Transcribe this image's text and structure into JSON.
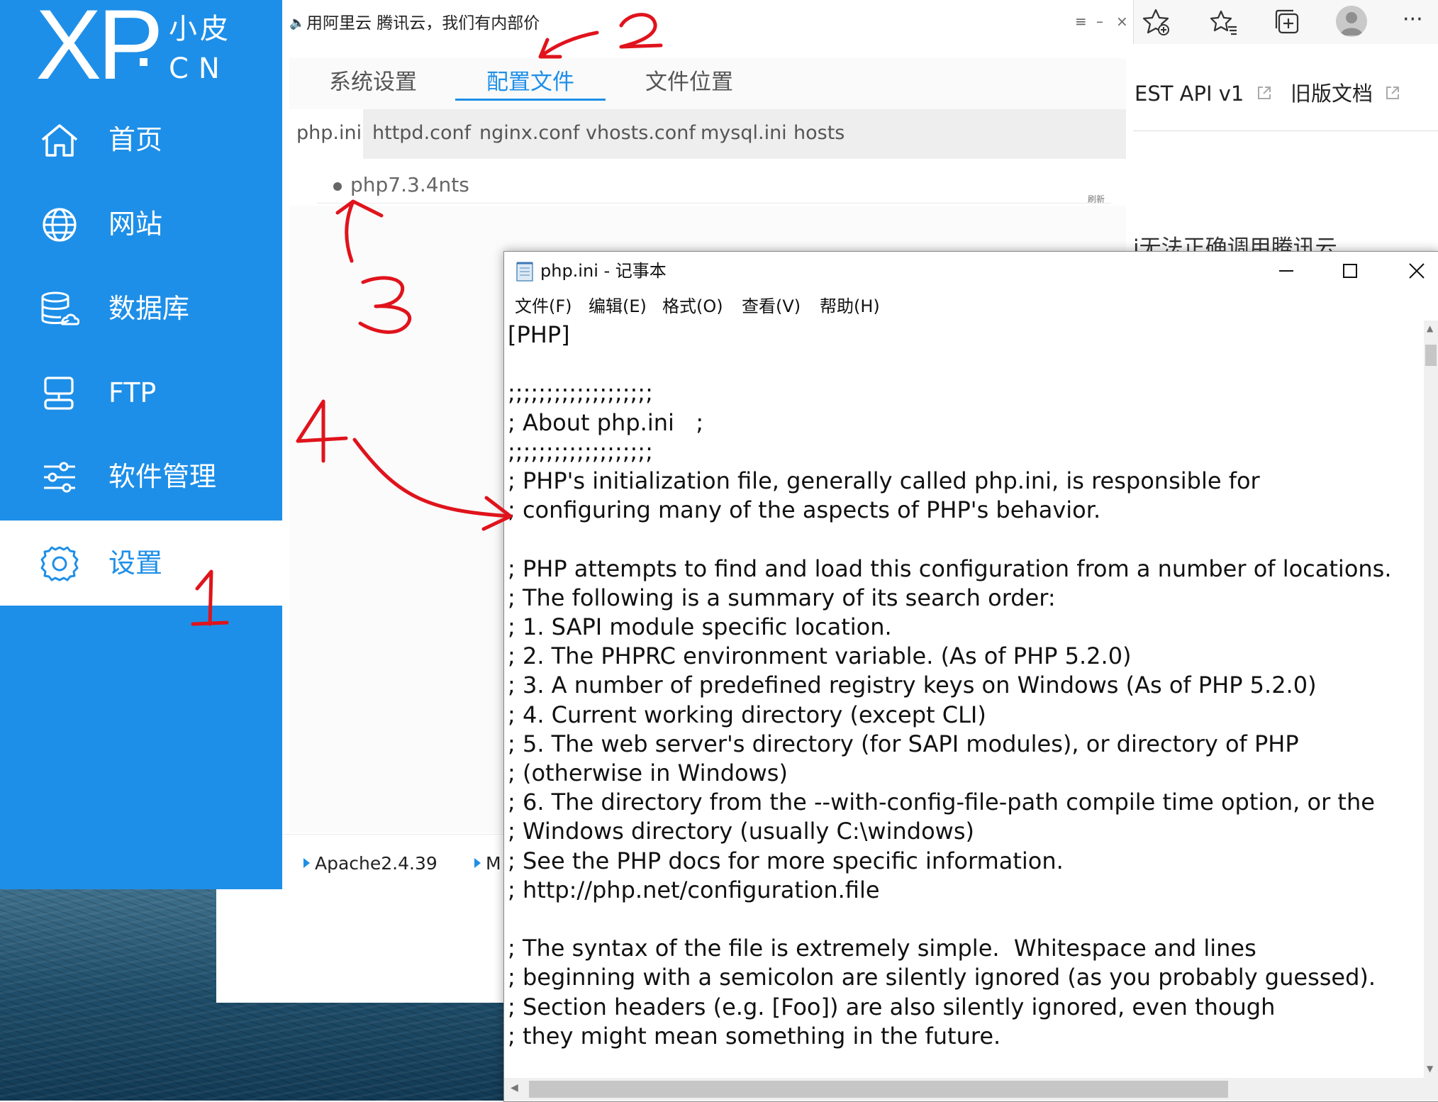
{
  "xp_app": {
    "logo": {
      "xp": "XP",
      "cn_top": "小皮",
      "cn_bottom": "CN"
    },
    "nav": [
      {
        "label": "首页",
        "icon": "home-icon"
      },
      {
        "label": "网站",
        "icon": "globe-icon"
      },
      {
        "label": "数据库",
        "icon": "database-icon"
      },
      {
        "label": "FTP",
        "icon": "ftp-icon"
      },
      {
        "label": "软件管理",
        "icon": "sliders-icon"
      },
      {
        "label": "设置",
        "icon": "gear-icon",
        "active": true
      }
    ],
    "ad_text": "用阿里云 腾讯云，我们有内部价",
    "window_controls": {
      "menu": "≡",
      "minimize": "–",
      "close": "×"
    },
    "tabs": [
      "系统设置",
      "配置文件",
      "文件位置"
    ],
    "active_tab": "配置文件",
    "config_tabs": [
      "php.ini",
      "httpd.conf",
      "nginx.conf",
      "vhosts.conf",
      "mysql.ini",
      "hosts"
    ],
    "active_config_tab": "php.ini",
    "php_version": "php7.3.4nts",
    "refresh_label": "刷新",
    "services": [
      "Apache2.4.39",
      "M"
    ]
  },
  "browser": {
    "nav_links": [
      "EST API v1",
      "旧版文档"
    ],
    "cut_text": "i无法正确调用腾讯云",
    "toolbar_icons": [
      "favorite-add-icon",
      "favorites-icon",
      "collections-icon",
      "profile-avatar",
      "more-icon"
    ],
    "more_label": "···"
  },
  "notepad": {
    "title": "php.ini - 记事本",
    "menu": [
      "文件(F)",
      "编辑(E)",
      "格式(O)",
      "查看(V)",
      "帮助(H)"
    ],
    "content": "[PHP]\n\n;;;;;;;;;;;;;;;;;;;\n; About php.ini   ;\n;;;;;;;;;;;;;;;;;;;\n; PHP's initialization file, generally called php.ini, is responsible for\n; configuring many of the aspects of PHP's behavior.\n\n; PHP attempts to find and load this configuration from a number of locations.\n; The following is a summary of its search order:\n; 1. SAPI module specific location.\n; 2. The PHPRC environment variable. (As of PHP 5.2.0)\n; 3. A number of predefined registry keys on Windows (As of PHP 5.2.0)\n; 4. Current working directory (except CLI)\n; 5. The web server's directory (for SAPI modules), or directory of PHP\n; (otherwise in Windows)\n; 6. The directory from the --with-config-file-path compile time option, or the\n; Windows directory (usually C:\\windows)\n; See the PHP docs for more specific information.\n; http://php.net/configuration.file\n\n; The syntax of the file is extremely simple.  Whitespace and lines\n; beginning with a semicolon are silently ignored (as you probably guessed).\n; Section headers (e.g. [Foo]) are also silently ignored, even though\n; they might mean something in the future."
  },
  "annotations": {
    "color": "#e0131c",
    "numbers": [
      "1",
      "2",
      "3",
      "4"
    ]
  },
  "colors": {
    "xp_blue": "#1e8fe8"
  }
}
